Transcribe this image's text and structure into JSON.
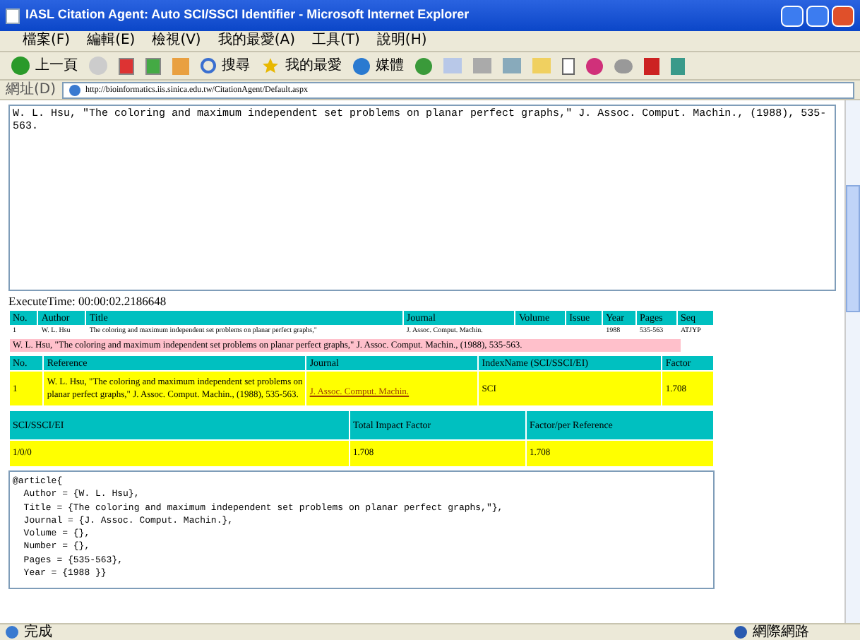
{
  "window": {
    "title": "IASL Citation Agent: Auto SCI/SSCI Identifier - Microsoft Internet Explorer"
  },
  "menu": [
    "檔案(F)",
    "編輯(E)",
    "檢視(V)",
    "我的最愛(A)",
    "工具(T)",
    "說明(H)"
  ],
  "toolbar": {
    "back": "上一頁",
    "search": "搜尋",
    "favorites": "我的最愛",
    "media": "媒體"
  },
  "address": {
    "label": "網址(D)",
    "value": "http://bioinformatics.iis.sinica.edu.tw/CitationAgent/Default.aspx"
  },
  "input_text": "W. L. Hsu, \"The coloring and maximum independent set problems on planar perfect graphs,\" J. Assoc. Comput. Machin., (1988), 535-563.",
  "execute_time": "ExecuteTime: 00:00:02.2186648",
  "parse_table": {
    "columns": [
      "No.",
      "Author",
      "Title",
      "Journal",
      "Volume",
      "Issue",
      "Year",
      "Pages",
      "Seq"
    ],
    "rows": [
      [
        "1",
        "W. L. Hsu",
        "The coloring and maximum independent set problems on planar perfect graphs,\"",
        "J. Assoc. Comput. Machin.",
        "",
        "",
        "1988",
        "535-563",
        "ATJYP"
      ]
    ]
  },
  "matched_reference": "W. L. Hsu, \"The coloring and maximum independent set problems on planar perfect graphs,\" J. Assoc. Comput. Machin., (1988), 535-563.",
  "result_table": {
    "columns": [
      "No.",
      "Reference",
      "Journal",
      "IndexName (SCI/SSCI/EI)",
      "Factor"
    ],
    "rows": [
      [
        "1",
        "W. L. Hsu, \"The coloring and maximum independent set problems on planar perfect graphs,\" J. Assoc. Comput. Machin., (1988), 535-563.",
        "J. Assoc. Comput. Machin.",
        "SCI",
        "1.708"
      ]
    ]
  },
  "summary_table": {
    "columns": [
      "SCI/SSCI/EI",
      "Total Impact Factor",
      "Factor/per Reference"
    ],
    "values": [
      "1/0/0",
      "1.708",
      "1.708"
    ]
  },
  "bibtex": [
    "@article{",
    "  Author = {W. L. Hsu},",
    "  Title = {The coloring and maximum independent set problems on planar perfect graphs,\"},",
    "  Journal = {J. Assoc. Comput. Machin.},",
    "  Volume = {},",
    "  Number = {},",
    "  Pages = {535-563},",
    "  Year = {1988 }}"
  ],
  "status_bar": {
    "left": "完成",
    "right": "網際網路"
  }
}
